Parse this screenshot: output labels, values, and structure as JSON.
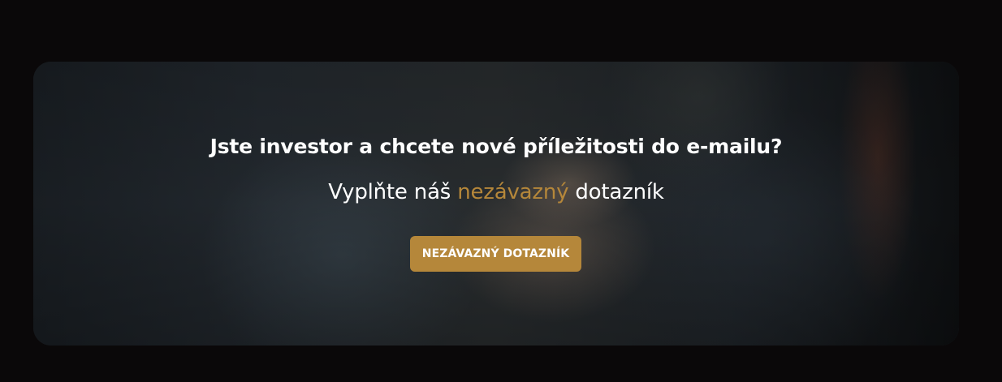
{
  "banner": {
    "headline": "Jste investor a chcete nové příležitosti do e-mailu?",
    "subline": {
      "before": "Vyplňte náš ",
      "highlight": "nezávazný",
      "after": " dotazník"
    },
    "cta_label": "NEZÁVAZNÝ DOTAZNÍK",
    "background_image": "handshake-photo"
  },
  "colors": {
    "page_background": "#0a0809",
    "accent": "#b5873a",
    "text": "#ffffff"
  }
}
